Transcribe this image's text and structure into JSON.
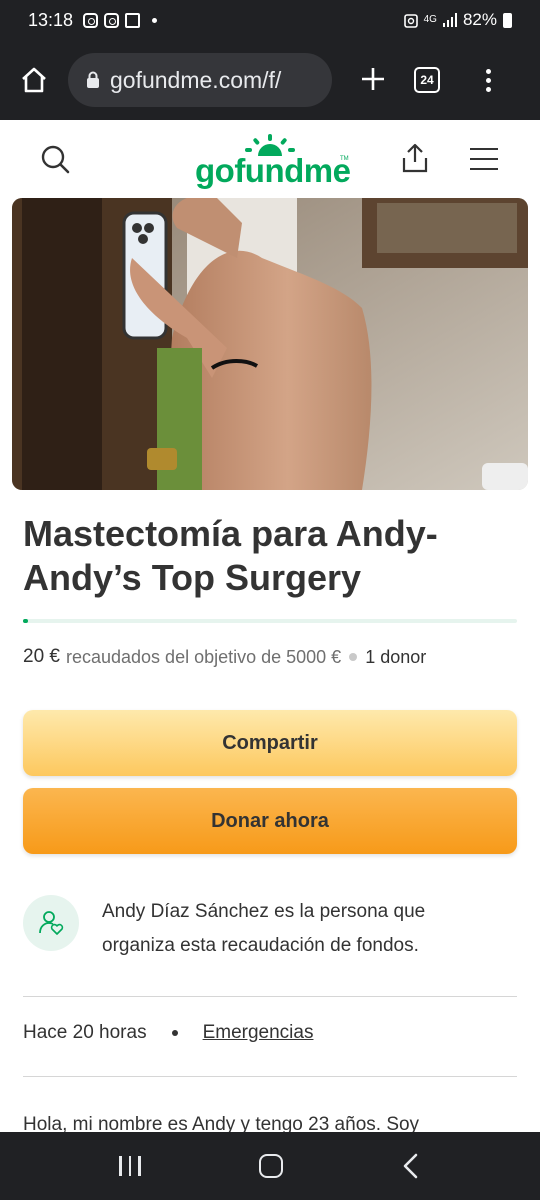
{
  "status_bar": {
    "time": "13:18",
    "network_label": "4G",
    "battery": "82%"
  },
  "browser": {
    "url": "gofundme.com/f/",
    "tab_count": "24"
  },
  "site": {
    "logo_text": "gofundme",
    "logo_tm": "TM",
    "brand_color": "#02a95c"
  },
  "campaign": {
    "title": "Mastectomía para Andy- Andy’s Top Surgery",
    "raised_amount": "20 €",
    "raised_text": "recaudados del objetivo de 5000 €",
    "donors": "1 donor",
    "progress_percent": 0.4,
    "share_label": "Compartir",
    "donate_label": "Donar ahora",
    "organizer_text": "Andy Díaz Sánchez es la persona que organiza esta recaudación de fondos.",
    "created": "Hace 20 horas",
    "category": "Emergencias",
    "story_start": "Hola, mi nombre es Andy y tengo 23 años. Soy"
  },
  "icons": [
    "instagram-icon",
    "gallery-icon",
    "signal-icon",
    "battery-icon",
    "home-icon",
    "lock-icon",
    "plus-icon",
    "tabs-icon",
    "more-icon",
    "search-icon",
    "share-icon",
    "hamburger-icon",
    "organizer-icon"
  ]
}
